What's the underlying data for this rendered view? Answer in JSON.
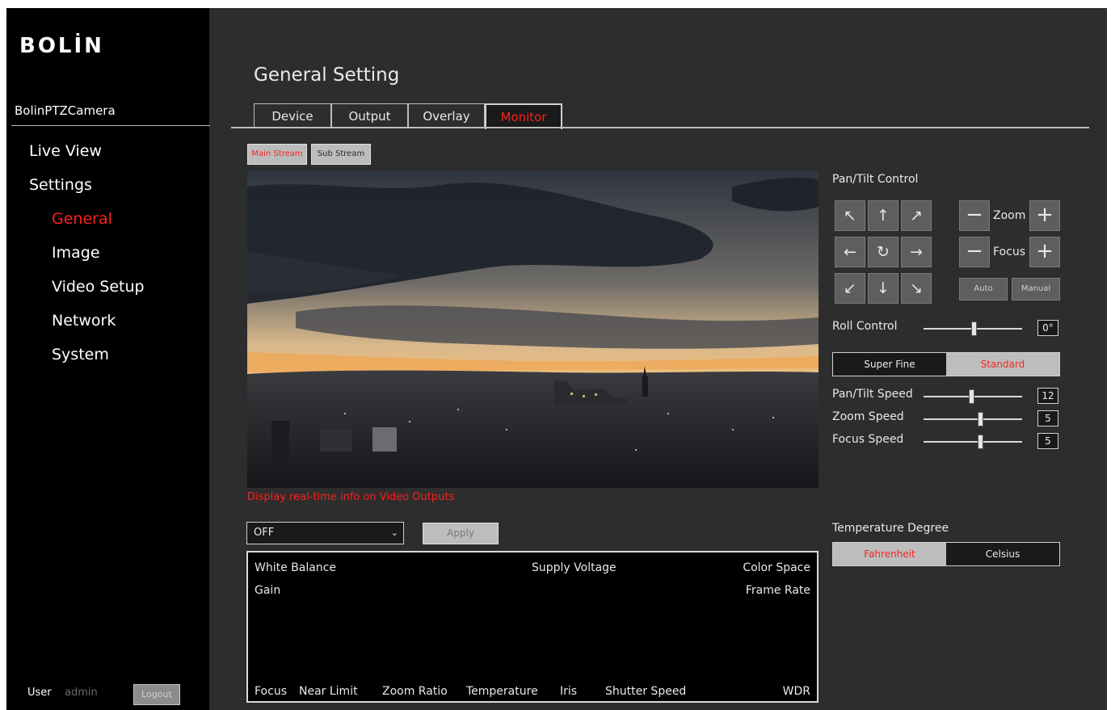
{
  "brand": {
    "logo": "BOLİN",
    "device_name": "BolinPTZCamera"
  },
  "nav": {
    "live_view": "Live View",
    "settings": "Settings",
    "general": "General",
    "image": "Image",
    "video_setup": "Video Setup",
    "network": "Network",
    "system": "System"
  },
  "footer": {
    "user_label": "User",
    "user_name": "admin",
    "logout": "Logout"
  },
  "page": {
    "title": "General Setting"
  },
  "tabs": [
    "Device",
    "Output",
    "Overlay",
    "Monitor"
  ],
  "active_tab": "Monitor",
  "stream": {
    "main": "Main Stream",
    "sub": "Sub Stream",
    "active": "Main Stream"
  },
  "monitor": {
    "warning": "Display real-time info on Video Outputs",
    "display_select": "OFF",
    "apply": "Apply",
    "info": {
      "white_balance": "White Balance",
      "supply_voltage": "Supply Voltage",
      "color_space": "Color Space",
      "gain": "Gain",
      "frame_rate": "Frame Rate",
      "focus": "Focus",
      "near_limit": "Near Limit",
      "zoom_ratio": "Zoom Ratio",
      "temperature": "Temperature",
      "iris": "Iris",
      "shutter_speed": "Shutter Speed",
      "wdr": "WDR"
    }
  },
  "ptz": {
    "title": "Pan/Tilt Control",
    "icons": [
      "arrow-up-left",
      "arrow-up",
      "arrow-up-right",
      "arrow-left",
      "home-refresh",
      "arrow-right",
      "arrow-down-left",
      "arrow-down",
      "arrow-down-right"
    ],
    "zoom_label": "Zoom",
    "focus_label": "Focus",
    "auto": "Auto",
    "manual": "Manual",
    "roll_label": "Roll Control",
    "roll_value": "0°",
    "mode_super_fine": "Super Fine",
    "mode_standard": "Standard",
    "mode_active": "Standard",
    "pan_tilt_speed_label": "Pan/Tilt Speed",
    "pan_tilt_speed_value": "12",
    "zoom_speed_label": "Zoom Speed",
    "zoom_speed_value": "5",
    "focus_speed_label": "Focus Speed",
    "focus_speed_value": "5"
  },
  "temperature": {
    "title": "Temperature Degree",
    "fahrenheit": "Fahrenheit",
    "celsius": "Celsius",
    "active": "Fahrenheit"
  },
  "colors": {
    "accent": "#ff1f1f",
    "panel": "#2d2d2d",
    "sidebar": "#000000"
  }
}
